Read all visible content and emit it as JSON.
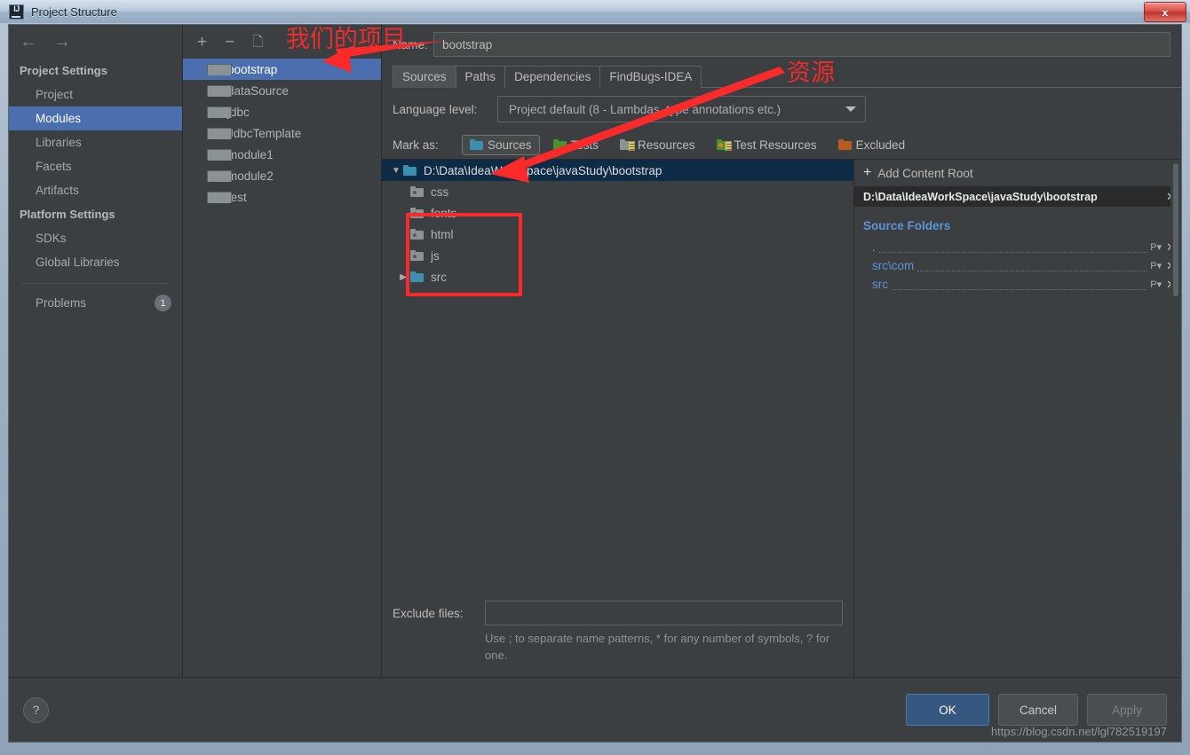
{
  "window": {
    "title": "Project Structure",
    "app_icon": "intellij-idea-icon",
    "close_label": "x"
  },
  "nav": {
    "back_icon": "arrow-left-icon",
    "forward_icon": "arrow-right-icon",
    "groups": [
      {
        "title": "Project Settings",
        "items": [
          {
            "label": "Project",
            "selected": false
          },
          {
            "label": "Modules",
            "selected": true
          },
          {
            "label": "Libraries",
            "selected": false
          },
          {
            "label": "Facets",
            "selected": false
          },
          {
            "label": "Artifacts",
            "selected": false
          }
        ]
      },
      {
        "title": "Platform Settings",
        "items": [
          {
            "label": "SDKs",
            "selected": false
          },
          {
            "label": "Global Libraries",
            "selected": false
          }
        ]
      }
    ],
    "problems": {
      "label": "Problems",
      "count": "1"
    }
  },
  "modules": {
    "toolbar": {
      "add": "+",
      "remove": "−",
      "copy": "copy-icon"
    },
    "items": [
      {
        "label": "bootstrap",
        "selected": true
      },
      {
        "label": "dataSource",
        "selected": false
      },
      {
        "label": "jdbc",
        "selected": false
      },
      {
        "label": "JdbcTemplate",
        "selected": false
      },
      {
        "label": "module1",
        "selected": false
      },
      {
        "label": "module2",
        "selected": false
      },
      {
        "label": "test",
        "selected": false
      }
    ]
  },
  "editor": {
    "name_label": "Name:",
    "name_value": "bootstrap",
    "tabs": [
      {
        "label": "Sources",
        "active": true
      },
      {
        "label": "Paths",
        "active": false
      },
      {
        "label": "Dependencies",
        "active": false
      },
      {
        "label": "FindBugs-IDEA",
        "active": false
      }
    ],
    "language_level_label": "Language level:",
    "language_level_value": "Project default (8 - Lambdas, type annotations etc.)",
    "mark_as_label": "Mark as:",
    "mark_as_buttons": [
      {
        "label": "Sources",
        "icon": "blue-folder-icon",
        "active": true
      },
      {
        "label": "Tests",
        "icon": "green-folder-icon",
        "active": false
      },
      {
        "label": "Resources",
        "icon": "gray-resource-folder-icon",
        "active": false
      },
      {
        "label": "Test Resources",
        "icon": "green-orange-resource-folder-icon",
        "active": false
      },
      {
        "label": "Excluded",
        "icon": "orange-folder-icon",
        "active": false
      }
    ]
  },
  "tree": {
    "root": {
      "label": "D:\\Data\\IdeaWorkSpace\\javaStudy\\bootstrap",
      "expanded": true,
      "selected": true
    },
    "children": [
      {
        "label": "css",
        "kind": "plain-folder",
        "expandable": false
      },
      {
        "label": "fonts",
        "kind": "plain-folder",
        "expandable": false
      },
      {
        "label": "html",
        "kind": "plain-folder",
        "expandable": false
      },
      {
        "label": "js",
        "kind": "plain-folder",
        "expandable": false
      },
      {
        "label": "src",
        "kind": "source-folder",
        "expandable": true
      }
    ]
  },
  "exclude": {
    "label": "Exclude files:",
    "value": "",
    "hint": "Use ; to separate name patterns, * for any number of symbols, ? for one."
  },
  "details": {
    "add_content_root": "Add Content Root",
    "content_root_path": "D:\\Data\\IdeaWorkSpace\\javaStudy\\bootstrap",
    "source_folders_title": "Source Folders",
    "source_folders": [
      {
        "name": "."
      },
      {
        "name": "src\\com"
      },
      {
        "name": "src"
      }
    ]
  },
  "footer": {
    "help_label": "?",
    "ok_label": "OK",
    "cancel_label": "Cancel",
    "apply_label": "Apply",
    "watermark": "https://blog.csdn.net/lgl782519197"
  },
  "annotations": {
    "project_note": "我们的项目",
    "resource_note": "资源",
    "accent_red": "#fa2a2a"
  }
}
